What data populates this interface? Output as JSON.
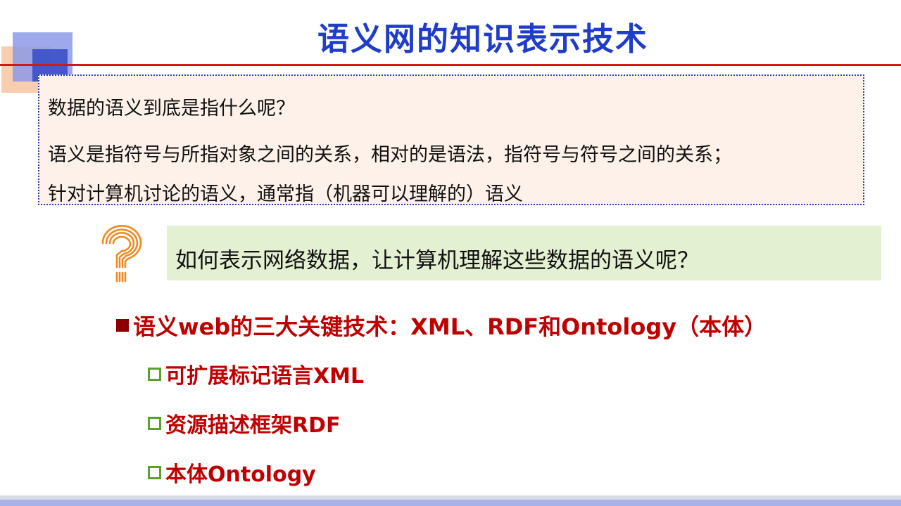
{
  "slide": {
    "title": "语义网的知识表示技术"
  },
  "definition_box": {
    "question": "数据的语义到底是指什么呢？",
    "answer_line1": "语义是指符号与所指对象之间的关系，相对的是语法，指符号与符号之间的关系；",
    "answer_line2": "针对计算机讨论的语义，通常指（机器可以理解的）语义"
  },
  "question_callout": {
    "icon": "question-mark-icon",
    "text": "如何表示网络数据，让计算机理解这些数据的语义呢？"
  },
  "bullets": {
    "main": "语义web的三大关键技术：XML、RDF和Ontology（本体）",
    "subs": [
      "可扩展标记语言XML",
      "资源描述框架RDF",
      "本体Ontology"
    ]
  },
  "colors": {
    "title": "#1f3dc8",
    "rule": "#d01818",
    "bullet_text": "#c00000",
    "question_box": "#e4f0d2",
    "definition_box": "#fdf1e9",
    "question_icon": "#f08a24"
  }
}
